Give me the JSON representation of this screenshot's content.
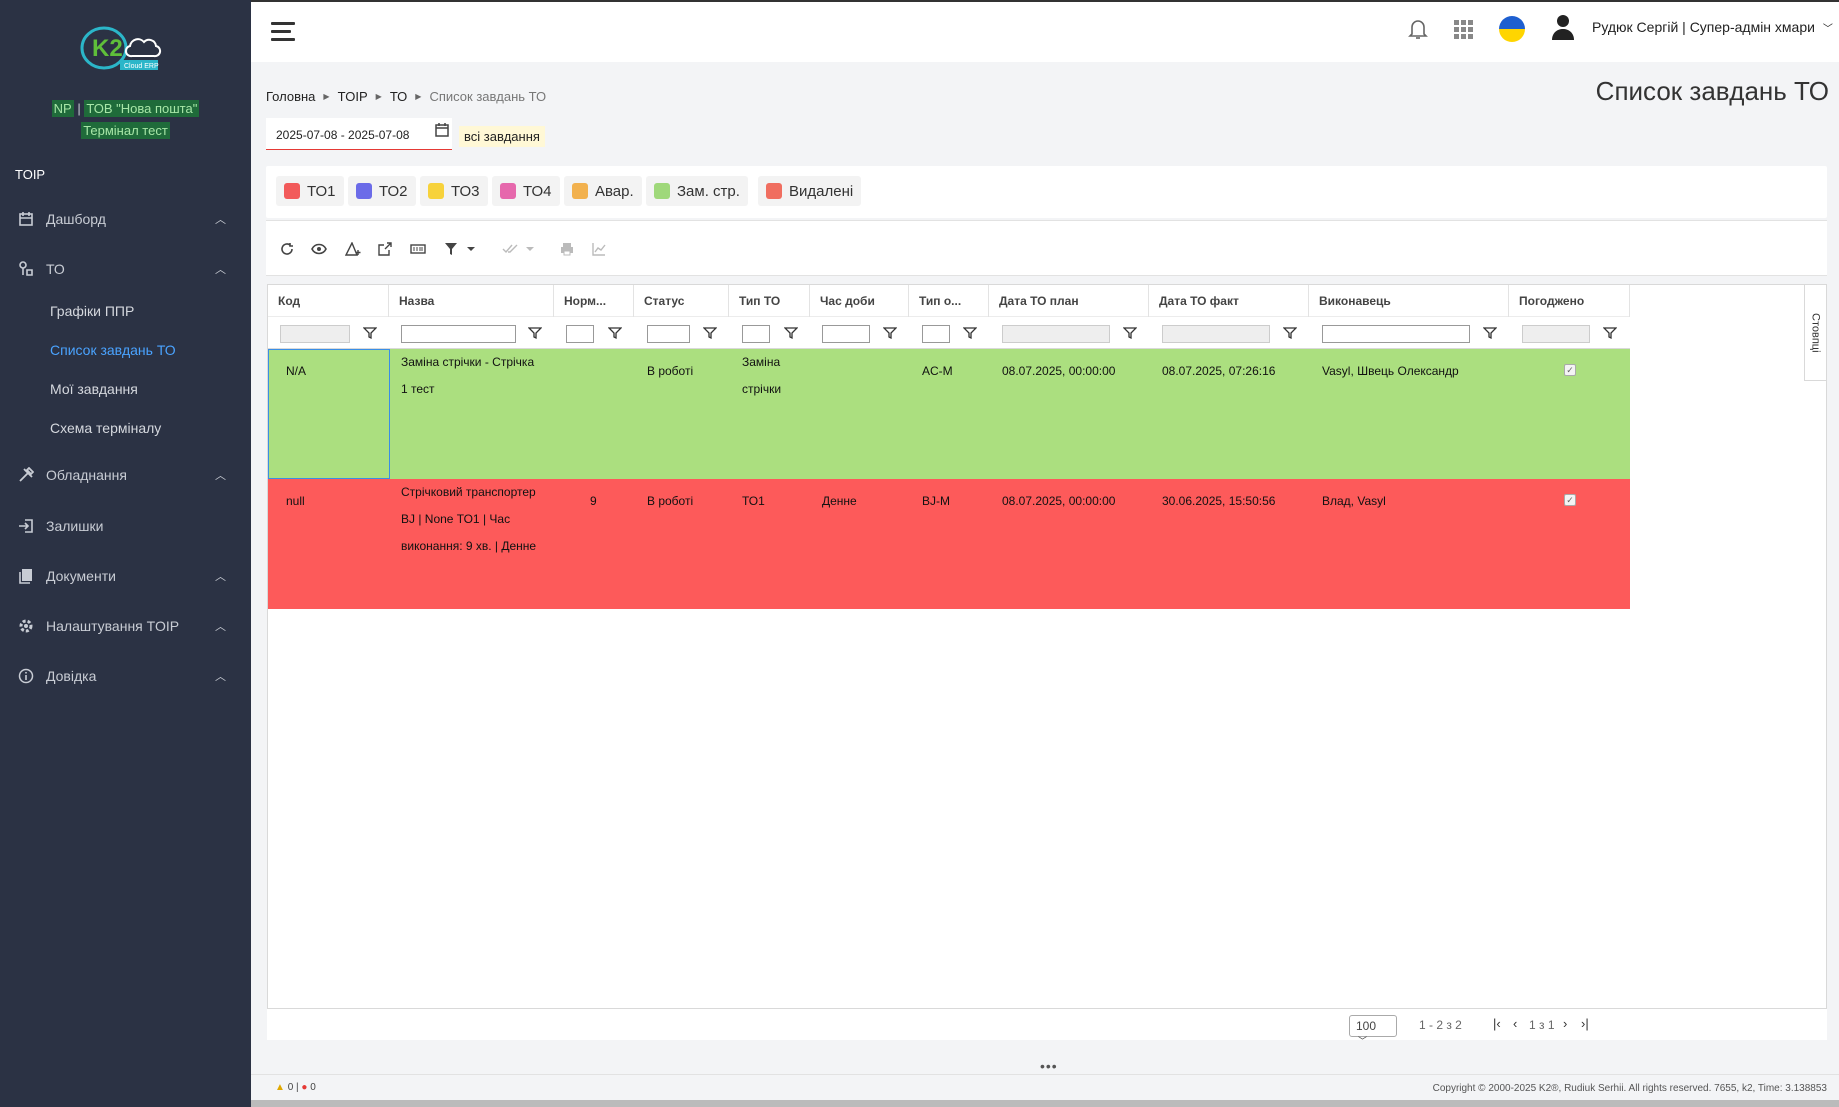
{
  "sidebar": {
    "logo_text": "K2",
    "logo_sub": "Cloud ERP",
    "org_code": "NP",
    "org_sep": "|",
    "org_name": "ТОВ \"Нова пошта\"",
    "terminal": "Термінал тест",
    "section": "TOIP",
    "items": [
      {
        "label": "Дашборд"
      },
      {
        "label": "ТО"
      },
      {
        "label": "Обладнання"
      },
      {
        "label": "Залишки"
      },
      {
        "label": "Документи"
      },
      {
        "label": "Налаштування TOIP"
      },
      {
        "label": "Довідка"
      }
    ],
    "sub_items": [
      {
        "label": "Графіки ППР"
      },
      {
        "label": "Список завдань ТО"
      },
      {
        "label": "Мої завдання"
      },
      {
        "label": "Схема терміналу"
      }
    ]
  },
  "topbar": {
    "user": "Рудюк Сергій | Супер-адмін хмари"
  },
  "breadcrumb": [
    "Головна",
    "TOIP",
    "ТО",
    "Список завдань ТО"
  ],
  "page_title": "Список завдань ТО",
  "filters": {
    "date_range": "2025-07-08 - 2025-07-08",
    "all_tasks": "всі завдання"
  },
  "legend": [
    {
      "label": "ТО1",
      "color": "#f25a5a"
    },
    {
      "label": "ТО2",
      "color": "#6b6be8"
    },
    {
      "label": "ТО3",
      "color": "#f7d23b"
    },
    {
      "label": "ТО4",
      "color": "#e668ac"
    },
    {
      "label": "Авар.",
      "color": "#f2b14e"
    },
    {
      "label": "Зам. стр.",
      "color": "#9fd87a"
    },
    {
      "label": "Видалені",
      "color": "#f06e60"
    }
  ],
  "grid": {
    "columns_tab": "Стовпці",
    "headers": [
      "Код",
      "Назва",
      "Норм...",
      "Статус",
      "Тип ТО",
      "Час доби",
      "Тип о...",
      "Дата ТО план",
      "Дата ТО факт",
      "Виконавець",
      "Погоджено"
    ],
    "rows": [
      {
        "color": "#abdf7f",
        "code": "N/A",
        "name": " Заміна стрічки - Стрічка 1 тест",
        "norm": "",
        "status": "В роботі",
        "type": "Заміна стрічки",
        "daytime": "",
        "eqtype": "AC-M",
        "plan": "08.07.2025, 00:00:00",
        "fact": "08.07.2025, 07:26:16",
        "executor": "Vasyl, Швець Олександр",
        "approved": true
      },
      {
        "color": "#fd5a5a",
        "code": "null",
        "name": " Стрічковий транспортер BJ | None ТО1 | Час виконання: 9 хв. | Денне",
        "norm": "9",
        "status": "В роботі",
        "type": "ТО1",
        "daytime": "Денне",
        "eqtype": "BJ-M",
        "plan": "08.07.2025, 00:00:00",
        "fact": "30.06.2025, 15:50:56",
        "executor": "Влад, Vasyl",
        "approved": true
      }
    ]
  },
  "pager": {
    "page_size": "100",
    "range": "1 - 2 з 2",
    "page_info": "1 з 1"
  },
  "footer": {
    "warnings": "0",
    "errors": "0",
    "copyright": "Copyright © 2000-2025 K2®, Rudiuk Serhii. All rights reserved. 7655, k2, Time: 3.138853"
  }
}
